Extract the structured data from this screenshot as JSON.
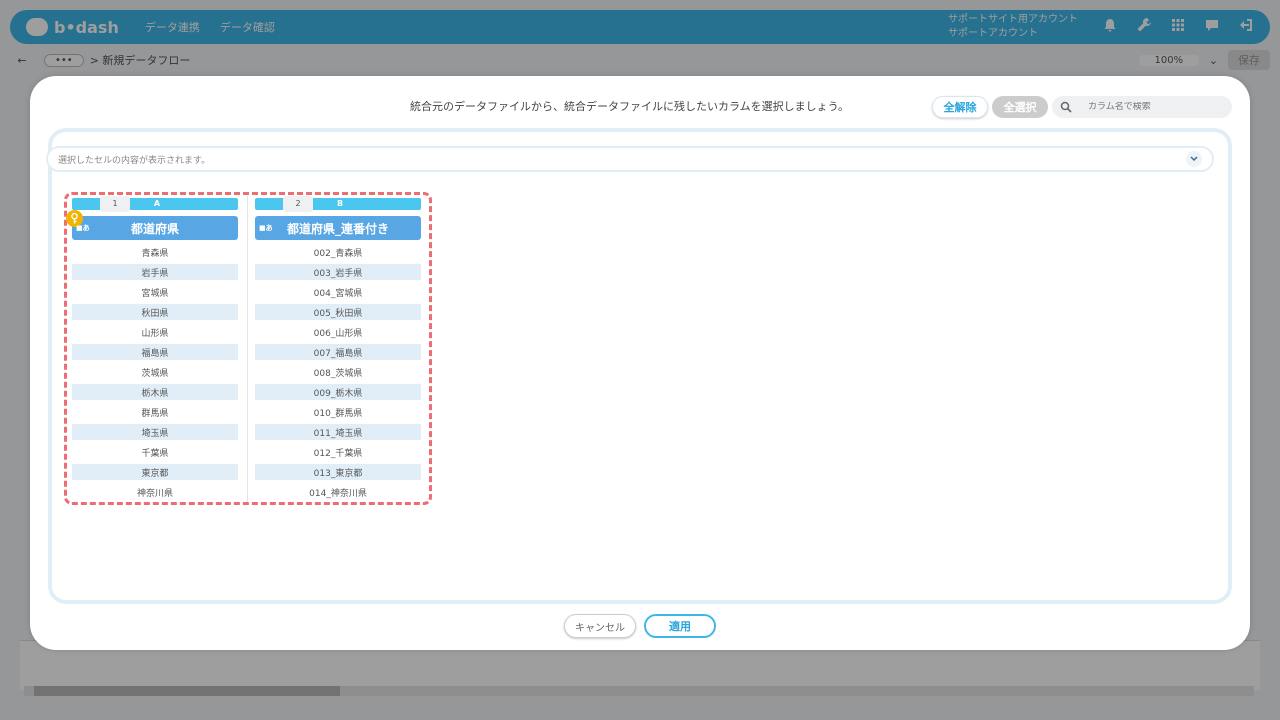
{
  "app": {
    "logo_text": "b•dash",
    "nav": [
      "データ連携",
      "データ確認"
    ],
    "account_line1": "サポートサイト用アカウント",
    "account_line2": "サポートアカウント",
    "icons": [
      "bell-icon",
      "wrench-icon",
      "grid-icon",
      "chat-icon",
      "logout-icon"
    ]
  },
  "subbar": {
    "back": "←",
    "more": "•••",
    "breadcrumb": "> 新規データフロー",
    "zoom": "100%",
    "save": "保存"
  },
  "modal": {
    "message": "統合元のデータファイルから、統合データファイルに残したいカラムを選択しましょう。",
    "deselect_all": "全解除",
    "select_all": "全選択",
    "search_placeholder": "カラム名で検索",
    "cell_placeholder": "選択したセルの内容が表示されます。",
    "cancel": "キャンセル",
    "apply": "適用"
  },
  "columns": [
    {
      "num": "1",
      "letter": "A",
      "type_badge": "あ",
      "header": "都道府県",
      "rows": [
        "青森県",
        "岩手県",
        "宮城県",
        "秋田県",
        "山形県",
        "福島県",
        "茨城県",
        "栃木県",
        "群馬県",
        "埼玉県",
        "千葉県",
        "東京都",
        "神奈川県"
      ]
    },
    {
      "num": "2",
      "letter": "B",
      "type_badge": "あ",
      "header": "都道府県_連番付き",
      "rows": [
        "002_青森県",
        "003_岩手県",
        "004_宮城県",
        "005_秋田県",
        "006_山形県",
        "007_福島県",
        "008_茨城県",
        "009_栃木県",
        "010_群馬県",
        "011_埼玉県",
        "012_千葉県",
        "013_東京都",
        "014_神奈川県"
      ]
    }
  ],
  "colors": {
    "brand": "#3fb6e8",
    "header_blue": "#59a6e4",
    "highlight_dash": "#ec6e72",
    "key_yellow": "#f2b400"
  }
}
